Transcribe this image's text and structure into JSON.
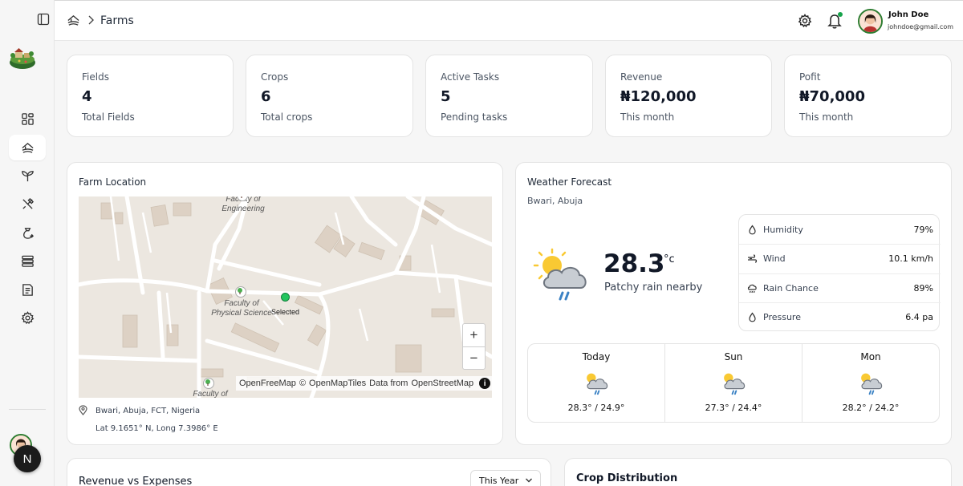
{
  "header": {
    "breadcrumb_title": "Farms",
    "user": {
      "name": "John Doe",
      "email": "johndoe@gmail.com"
    }
  },
  "sidebar": {
    "items": [
      {
        "icon": "dashboard-icon",
        "active": false
      },
      {
        "icon": "farms-icon",
        "active": true
      },
      {
        "icon": "sprout-icon",
        "active": false
      },
      {
        "icon": "tools-icon",
        "active": false
      },
      {
        "icon": "money-bag-icon",
        "active": false
      },
      {
        "icon": "stack-icon",
        "active": false
      },
      {
        "icon": "report-icon",
        "active": false
      },
      {
        "icon": "settings-icon",
        "active": false
      }
    ],
    "fab_letter": "N"
  },
  "stats": [
    {
      "label": "Fields",
      "value": "4",
      "sub": "Total Fields"
    },
    {
      "label": "Crops",
      "value": "6",
      "sub": "Total crops"
    },
    {
      "label": "Active Tasks",
      "value": "5",
      "sub": "Pending tasks"
    },
    {
      "label": "Revenue",
      "value": "₦120,000",
      "sub": "This month"
    },
    {
      "label": "Pofit",
      "value": "₦70,000",
      "sub": "This month"
    }
  ],
  "farm_location": {
    "title": "Farm Location",
    "map": {
      "labels": {
        "engineering": "Faculty of Engineering",
        "physical_science": "Faculty of Physical Science",
        "bottom": "Faculty of"
      },
      "marker_label": "Selected",
      "zoom_in": "+",
      "zoom_out": "−",
      "attribution": {
        "openfreemap": "OpenFreeMap",
        "copy": "©",
        "openmaptiles": "OpenMapTiles",
        "data_from": "Data from",
        "osm": "OpenStreetMap",
        "info": "i"
      }
    },
    "address": "Bwari, Abuja, FCT, Nigeria",
    "coords": "Lat 9.1651° N, Long 7.3986° E"
  },
  "weather": {
    "title": "Weather Forecast",
    "location": "Bwari, Abuja",
    "temp": "28.3",
    "unit": "°c",
    "description": "Patchy rain nearby",
    "stats": [
      {
        "label": "Humidity",
        "value": "79%",
        "icon": "droplet-icon"
      },
      {
        "label": "Wind",
        "value": "10.1 km/h",
        "icon": "wind-icon"
      },
      {
        "label": "Rain Chance",
        "value": "89%",
        "icon": "rain-cloud-icon"
      },
      {
        "label": "Pressure",
        "value": "6.4 pa",
        "icon": "droplet-icon"
      }
    ],
    "forecast": [
      {
        "day": "Today",
        "temps": "28.3° / 24.9°"
      },
      {
        "day": "Sun",
        "temps": "27.3° / 24.4°"
      },
      {
        "day": "Mon",
        "temps": "28.2° / 24.2°"
      }
    ]
  },
  "revenue_card": {
    "title": "Revenue vs Expenses",
    "period": "This Year"
  },
  "crop_card": {
    "title": "Crop Distribution"
  }
}
